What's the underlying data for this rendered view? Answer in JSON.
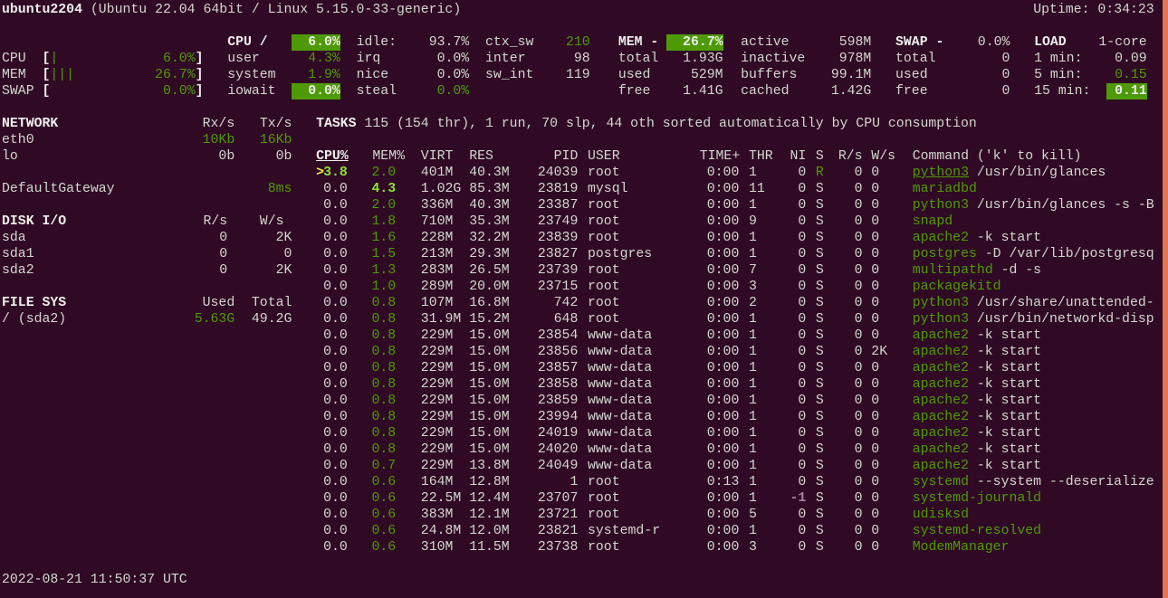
{
  "header": {
    "hostname": "ubuntu2204",
    "system": "(Ubuntu 22.04 64bit / Linux 5.15.0-33-generic)",
    "uptime": "Uptime: 0:34:23"
  },
  "quicklook": {
    "cpu": {
      "label": "CPU",
      "bar_open": "[",
      "bar": "|",
      "value": "6.0%",
      "bar_close": "]"
    },
    "mem": {
      "label": "MEM",
      "bar_open": "[",
      "bar": "|||",
      "value": "26.7%",
      "bar_close": "]"
    },
    "swap": {
      "label": "SWAP",
      "bar_open": "[",
      "bar": "",
      "value": "0.0%",
      "bar_close": "]"
    }
  },
  "cpu": {
    "title": "CPU /",
    "total": "6.0%",
    "rows": [
      {
        "label": "user",
        "value": "4.3%"
      },
      {
        "label": "system",
        "value": "1.9%"
      },
      {
        "label": "iowait",
        "value": "0.0%"
      }
    ],
    "col2": [
      {
        "label": "idle:",
        "value": "93.7%"
      },
      {
        "label": "irq",
        "value": "0.0%"
      },
      {
        "label": "nice",
        "value": "0.0%"
      },
      {
        "label": "steal",
        "value": "0.0%"
      }
    ],
    "col3": [
      {
        "label": "ctx_sw",
        "value": "210"
      },
      {
        "label": "inter",
        "value": "98"
      },
      {
        "label": "sw_int",
        "value": "119"
      }
    ]
  },
  "mem": {
    "title": "MEM -",
    "percent": "26.7%",
    "col1": [
      {
        "label": "total",
        "value": "1.93G"
      },
      {
        "label": "used",
        "value": "529M"
      },
      {
        "label": "free",
        "value": "1.41G"
      }
    ],
    "col2": [
      {
        "label": "active",
        "value": "598M"
      },
      {
        "label": "inactive",
        "value": "978M"
      },
      {
        "label": "buffers",
        "value": "99.1M"
      },
      {
        "label": "cached",
        "value": "1.42G"
      }
    ]
  },
  "swap": {
    "title": "SWAP -",
    "percent": "0.0%",
    "rows": [
      {
        "label": "total",
        "value": "0"
      },
      {
        "label": "used",
        "value": "0"
      },
      {
        "label": "free",
        "value": "0"
      }
    ]
  },
  "load": {
    "title": "LOAD",
    "cores": "1-core",
    "rows": [
      {
        "label": "1 min:",
        "value": "0.09"
      },
      {
        "label": "5 min:",
        "value": "0.15"
      },
      {
        "label": "15 min:",
        "value": "0.11"
      }
    ]
  },
  "network": {
    "title": "NETWORK",
    "rx_header": "Rx/s",
    "tx_header": "Tx/s",
    "interfaces": [
      {
        "name": "eth0",
        "rx": "10Kb",
        "tx": "16Kb"
      },
      {
        "name": "lo",
        "rx": "0b",
        "tx": "0b"
      }
    ],
    "gateway": {
      "name": "DefaultGateway",
      "latency": "8ms"
    }
  },
  "diskio": {
    "title": "DISK I/O",
    "r_header": "R/s",
    "w_header": "W/s",
    "disks": [
      {
        "name": "sda",
        "r": "0",
        "w": "2K"
      },
      {
        "name": "sda1",
        "r": "0",
        "w": "0"
      },
      {
        "name": "sda2",
        "r": "0",
        "w": "2K"
      }
    ]
  },
  "filesys": {
    "title": "FILE SYS",
    "used_header": "Used",
    "total_header": "Total",
    "mounts": [
      {
        "name": "/ (sda2)",
        "used": "5.63G",
        "total": "49.2G"
      }
    ]
  },
  "tasks": {
    "title": "TASKS",
    "summary": "115 (154 thr), 1 run, 70 slp, 44 oth sorted automatically by CPU consumption"
  },
  "processes": {
    "headers": {
      "cpu": "CPU%",
      "mem": "MEM%",
      "virt": "VIRT",
      "res": "RES",
      "pid": "PID",
      "user": "USER",
      "time": "TIME+",
      "thr": "THR",
      "ni": "NI",
      "s": "S",
      "rs": "R/s",
      "ws": "W/s",
      "command": "Command ('k' to kill)"
    },
    "sort_marker": ">",
    "rows": [
      {
        "cpu": "3.8",
        "mem": "2.0",
        "virt": "401M",
        "res": "40.3M",
        "pid": "24039",
        "user": "root",
        "time": "0:00",
        "thr": "1",
        "ni": "0",
        "s": "R",
        "rs": "0",
        "ws": "0",
        "cmd": "python3",
        "args": " /usr/bin/glances",
        "cpu_hot": true,
        "selected": true
      },
      {
        "cpu": "0.0",
        "mem": "4.3",
        "virt": "1.02G",
        "res": "85.3M",
        "pid": "23819",
        "user": "mysql",
        "time": "0:00",
        "thr": "11",
        "ni": "0",
        "s": "S",
        "rs": "0",
        "ws": "0",
        "cmd": "mariadbd",
        "args": "",
        "mem_hot": true
      },
      {
        "cpu": "0.0",
        "mem": "2.0",
        "virt": "336M",
        "res": "40.3M",
        "pid": "23387",
        "user": "root",
        "time": "0:00",
        "thr": "1",
        "ni": "0",
        "s": "S",
        "rs": "0",
        "ws": "0",
        "cmd": "python3",
        "args": " /usr/bin/glances -s -B"
      },
      {
        "cpu": "0.0",
        "mem": "1.8",
        "virt": "710M",
        "res": "35.3M",
        "pid": "23749",
        "user": "root",
        "time": "0:00",
        "thr": "9",
        "ni": "0",
        "s": "S",
        "rs": "0",
        "ws": "0",
        "cmd": "snapd",
        "args": ""
      },
      {
        "cpu": "0.0",
        "mem": "1.6",
        "virt": "228M",
        "res": "32.2M",
        "pid": "23839",
        "user": "root",
        "time": "0:00",
        "thr": "1",
        "ni": "0",
        "s": "S",
        "rs": "0",
        "ws": "0",
        "cmd": "apache2",
        "args": " -k start"
      },
      {
        "cpu": "0.0",
        "mem": "1.5",
        "virt": "213M",
        "res": "29.3M",
        "pid": "23827",
        "user": "postgres",
        "time": "0:00",
        "thr": "1",
        "ni": "0",
        "s": "S",
        "rs": "0",
        "ws": "0",
        "cmd": "postgres",
        "args": " -D /var/lib/postgresq"
      },
      {
        "cpu": "0.0",
        "mem": "1.3",
        "virt": "283M",
        "res": "26.5M",
        "pid": "23739",
        "user": "root",
        "time": "0:00",
        "thr": "7",
        "ni": "0",
        "s": "S",
        "rs": "0",
        "ws": "0",
        "cmd": "multipathd",
        "args": " -d -s"
      },
      {
        "cpu": "0.0",
        "mem": "1.0",
        "virt": "289M",
        "res": "20.0M",
        "pid": "23715",
        "user": "root",
        "time": "0:00",
        "thr": "3",
        "ni": "0",
        "s": "S",
        "rs": "0",
        "ws": "0",
        "cmd": "packagekitd",
        "args": ""
      },
      {
        "cpu": "0.0",
        "mem": "0.8",
        "virt": "107M",
        "res": "16.8M",
        "pid": "742",
        "user": "root",
        "time": "0:00",
        "thr": "2",
        "ni": "0",
        "s": "S",
        "rs": "0",
        "ws": "0",
        "cmd": "python3",
        "args": " /usr/share/unattended-"
      },
      {
        "cpu": "0.0",
        "mem": "0.8",
        "virt": "31.9M",
        "res": "15.2M",
        "pid": "648",
        "user": "root",
        "time": "0:00",
        "thr": "1",
        "ni": "0",
        "s": "S",
        "rs": "0",
        "ws": "0",
        "cmd": "python3",
        "args": " /usr/bin/networkd-disp"
      },
      {
        "cpu": "0.0",
        "mem": "0.8",
        "virt": "229M",
        "res": "15.0M",
        "pid": "23854",
        "user": "www-data",
        "time": "0:00",
        "thr": "1",
        "ni": "0",
        "s": "S",
        "rs": "0",
        "ws": "0",
        "cmd": "apache2",
        "args": " -k start"
      },
      {
        "cpu": "0.0",
        "mem": "0.8",
        "virt": "229M",
        "res": "15.0M",
        "pid": "23856",
        "user": "www-data",
        "time": "0:00",
        "thr": "1",
        "ni": "0",
        "s": "S",
        "rs": "0",
        "ws": "2K",
        "cmd": "apache2",
        "args": " -k start"
      },
      {
        "cpu": "0.0",
        "mem": "0.8",
        "virt": "229M",
        "res": "15.0M",
        "pid": "23857",
        "user": "www-data",
        "time": "0:00",
        "thr": "1",
        "ni": "0",
        "s": "S",
        "rs": "0",
        "ws": "0",
        "cmd": "apache2",
        "args": " -k start"
      },
      {
        "cpu": "0.0",
        "mem": "0.8",
        "virt": "229M",
        "res": "15.0M",
        "pid": "23858",
        "user": "www-data",
        "time": "0:00",
        "thr": "1",
        "ni": "0",
        "s": "S",
        "rs": "0",
        "ws": "0",
        "cmd": "apache2",
        "args": " -k start"
      },
      {
        "cpu": "0.0",
        "mem": "0.8",
        "virt": "229M",
        "res": "15.0M",
        "pid": "23859",
        "user": "www-data",
        "time": "0:00",
        "thr": "1",
        "ni": "0",
        "s": "S",
        "rs": "0",
        "ws": "0",
        "cmd": "apache2",
        "args": " -k start"
      },
      {
        "cpu": "0.0",
        "mem": "0.8",
        "virt": "229M",
        "res": "15.0M",
        "pid": "23994",
        "user": "www-data",
        "time": "0:00",
        "thr": "1",
        "ni": "0",
        "s": "S",
        "rs": "0",
        "ws": "0",
        "cmd": "apache2",
        "args": " -k start"
      },
      {
        "cpu": "0.0",
        "mem": "0.8",
        "virt": "229M",
        "res": "15.0M",
        "pid": "24019",
        "user": "www-data",
        "time": "0:00",
        "thr": "1",
        "ni": "0",
        "s": "S",
        "rs": "0",
        "ws": "0",
        "cmd": "apache2",
        "args": " -k start"
      },
      {
        "cpu": "0.0",
        "mem": "0.8",
        "virt": "229M",
        "res": "15.0M",
        "pid": "24020",
        "user": "www-data",
        "time": "0:00",
        "thr": "1",
        "ni": "0",
        "s": "S",
        "rs": "0",
        "ws": "0",
        "cmd": "apache2",
        "args": " -k start"
      },
      {
        "cpu": "0.0",
        "mem": "0.7",
        "virt": "229M",
        "res": "13.8M",
        "pid": "24049",
        "user": "www-data",
        "time": "0:00",
        "thr": "1",
        "ni": "0",
        "s": "S",
        "rs": "0",
        "ws": "0",
        "cmd": "apache2",
        "args": " -k start"
      },
      {
        "cpu": "0.0",
        "mem": "0.6",
        "virt": "164M",
        "res": "12.8M",
        "pid": "1",
        "user": "root",
        "time": "0:13",
        "thr": "1",
        "ni": "0",
        "s": "S",
        "rs": "0",
        "ws": "0",
        "cmd": "systemd",
        "args": " --system --deserialize"
      },
      {
        "cpu": "0.0",
        "mem": "0.6",
        "virt": "22.5M",
        "res": "12.4M",
        "pid": "23707",
        "user": "root",
        "time": "0:00",
        "thr": "1",
        "ni": "-1",
        "s": "S",
        "rs": "0",
        "ws": "0",
        "cmd": "systemd-journald",
        "args": "",
        "ni_hot": true
      },
      {
        "cpu": "0.0",
        "mem": "0.6",
        "virt": "383M",
        "res": "12.1M",
        "pid": "23721",
        "user": "root",
        "time": "0:00",
        "thr": "5",
        "ni": "0",
        "s": "S",
        "rs": "0",
        "ws": "0",
        "cmd": "udisksd",
        "args": ""
      },
      {
        "cpu": "0.0",
        "mem": "0.6",
        "virt": "24.8M",
        "res": "12.0M",
        "pid": "23821",
        "user": "systemd-r",
        "time": "0:00",
        "thr": "1",
        "ni": "0",
        "s": "S",
        "rs": "0",
        "ws": "0",
        "cmd": "systemd-resolved",
        "args": ""
      },
      {
        "cpu": "0.0",
        "mem": "0.6",
        "virt": "310M",
        "res": "11.5M",
        "pid": "23738",
        "user": "root",
        "time": "0:00",
        "thr": "3",
        "ni": "0",
        "s": "S",
        "rs": "0",
        "ws": "0",
        "cmd": "ModemManager",
        "args": ""
      }
    ]
  },
  "footer": {
    "datetime": "2022-08-21 11:50:37 UTC"
  },
  "colors": {
    "background": "#300a24",
    "text": "#d3d7cf",
    "ok_green": "#4e9a06",
    "highlight_green": "#8ae234",
    "sort_marker_yellow": "#fce94f",
    "nice_magenta": "#ad7fa8",
    "window_edge": "#e0774e"
  }
}
